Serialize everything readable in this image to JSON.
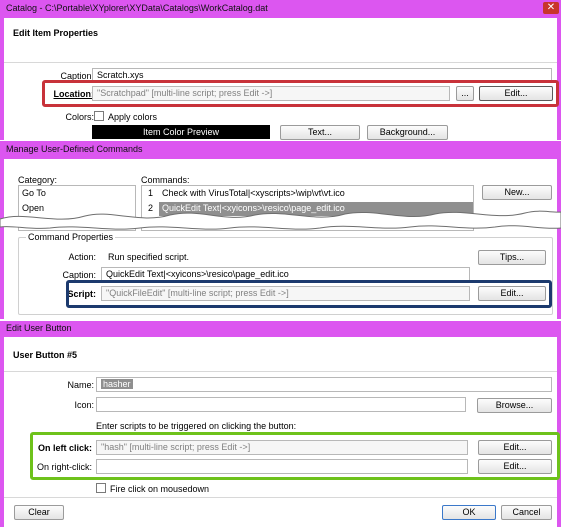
{
  "catalog_window": {
    "title": "Catalog  -  C:\\Portable\\XYplorer\\XYData\\Catalogs\\WorkCatalog.dat",
    "heading": "Edit Item Properties",
    "caption_label": "Caption:",
    "caption_value": "Scratch.xys",
    "location_label": "Location:",
    "location_value": "\"Scratchpad\" [multi-line script; press Edit ->]",
    "browse_label": "...",
    "edit_label": "Edit...",
    "colors_label": "Colors:",
    "apply_colors_label": "Apply colors",
    "preview_label": "Item Color Preview",
    "text_button": "Text...",
    "background_button": "Background..."
  },
  "commands_window": {
    "title": "Manage User-Defined Commands",
    "category_label": "Category:",
    "categories": [
      "Go To",
      "Open"
    ],
    "commands_label": "Commands:",
    "commands": [
      {
        "num": "1",
        "text": "Check with VirusTotal|<xyscripts>\\wip\\vt\\vt.ico"
      },
      {
        "num": "2",
        "text": "QuickEdit Text|<xyicons>\\resico\\page_edit.ico"
      }
    ],
    "new_button": "New...",
    "group_label": "Command Properties",
    "action_label": "Action:",
    "action_value": "Run specified script.",
    "tips_button": "Tips...",
    "caption_label": "Caption:",
    "caption_value": "QuickEdit Text|<xyicons>\\resico\\page_edit.ico",
    "script_label": "Script:",
    "script_value": "\"QuickFileEdit\" [multi-line script; press Edit ->]",
    "edit_label": "Edit..."
  },
  "user_button_window": {
    "title": "Edit User Button",
    "heading": "User Button #5",
    "name_label": "Name:",
    "name_value": "hasher",
    "icon_label": "Icon:",
    "browse_button": "Browse...",
    "instructions": "Enter scripts to be triggered on clicking the button:",
    "left_click_label": "On left click:",
    "left_click_value": "\"hash\" [multi-line script; press Edit ->]",
    "right_click_label": "On right-click:",
    "right_click_value": "",
    "edit_label": "Edit...",
    "fire_label": "Fire click on mousedown",
    "clear_button": "Clear",
    "ok_button": "OK",
    "cancel_button": "Cancel"
  },
  "colors": {
    "titlebar": "#dc56f0",
    "highlight_red": "#c8323a",
    "highlight_navy": "#1c3a6e",
    "highlight_green": "#6ec21b",
    "selection": "#8f8f8f",
    "close_button": "#c8352b"
  }
}
